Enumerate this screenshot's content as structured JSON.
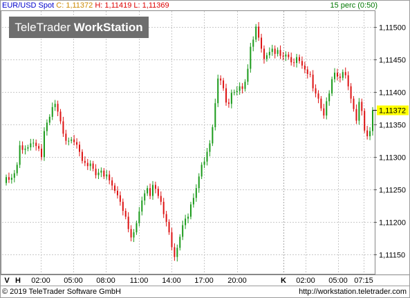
{
  "header": {
    "symbol": "EUR/USD Spot",
    "close_label": "C: 1,11372",
    "high_label": "H: 1,11419",
    "low_label": "L: 1,11369",
    "interval": "15 perc (0:50)"
  },
  "logo": {
    "word1": "TeleTrader",
    "word2": "WorkStation"
  },
  "footer": {
    "copyright": "© 2019 TeleTrader Software GmbH",
    "url": "http://workstation.teletrader.com"
  },
  "colors": {
    "up": "#1a9a1a",
    "down": "#dd1111",
    "grid": "#c8c8c8",
    "last_price_bg": "#ffff00",
    "close_label": "#cc8800",
    "high_label": "#dd0000",
    "low_label": "#dd0000",
    "interval_label": "#007700"
  },
  "chart_data": {
    "type": "candlestick",
    "title": "EUR/USD Spot",
    "interval": "15 perc",
    "y_ticks": [
      "1,11500",
      "1,11450",
      "1,11400",
      "1,11350",
      "1,11300",
      "1,11250",
      "1,11200",
      "1,11150"
    ],
    "ylim": [
      1.1112,
      1.11525
    ],
    "last_price": 1.11372,
    "last_price_label": "1,11372",
    "x_ticks": [
      {
        "label": "V",
        "bold": true
      },
      {
        "label": "H",
        "bold": true
      },
      {
        "label": "02:00"
      },
      {
        "label": "05:00"
      },
      {
        "label": "08:00"
      },
      {
        "label": "11:00"
      },
      {
        "label": "14:00"
      },
      {
        "label": "17:00"
      },
      {
        "label": "20:00"
      },
      {
        "label": "K",
        "bold": true
      },
      {
        "label": "02:00"
      },
      {
        "label": "05:00"
      },
      {
        "label": "07:15"
      }
    ],
    "close_series": [
      1.11269,
      1.11265,
      1.11268,
      1.11275,
      1.11288,
      1.11318,
      1.11311,
      1.11313,
      1.11315,
      1.11321,
      1.11322,
      1.11317,
      1.11313,
      1.113,
      1.1134,
      1.11353,
      1.11362,
      1.11377,
      1.11382,
      1.1137,
      1.11355,
      1.11336,
      1.11325,
      1.11325,
      1.11327,
      1.11323,
      1.11319,
      1.11308,
      1.11294,
      1.11291,
      1.11286,
      1.1129,
      1.11282,
      1.11272,
      1.11276,
      1.11279,
      1.1127,
      1.11273,
      1.11264,
      1.11256,
      1.11248,
      1.11241,
      1.11231,
      1.11217,
      1.11208,
      1.11189,
      1.11176,
      1.11184,
      1.11198,
      1.11216,
      1.11233,
      1.11244,
      1.11252,
      1.1124,
      1.11257,
      1.11251,
      1.1124,
      1.11231,
      1.11212,
      1.112,
      1.11184,
      1.11161,
      1.11146,
      1.1116,
      1.11177,
      1.11195,
      1.11205,
      1.11208,
      1.11227,
      1.11237,
      1.11252,
      1.1127,
      1.11288,
      1.11293,
      1.11308,
      1.11321,
      1.11346,
      1.11383,
      1.11421,
      1.11418,
      1.11406,
      1.11384,
      1.11382,
      1.11399,
      1.114,
      1.11402,
      1.11409,
      1.11405,
      1.11416,
      1.11436,
      1.1147,
      1.11481,
      1.11501,
      1.11484,
      1.11467,
      1.11451,
      1.11457,
      1.11462,
      1.11467,
      1.11459,
      1.11465,
      1.11456,
      1.11455,
      1.11458,
      1.11454,
      1.11446,
      1.11445,
      1.11454,
      1.11448,
      1.11441,
      1.11435,
      1.11428,
      1.11427,
      1.11406,
      1.11398,
      1.1139,
      1.11375,
      1.11364,
      1.11386,
      1.11398,
      1.1142,
      1.1143,
      1.11424,
      1.11422,
      1.11431,
      1.11426,
      1.11409,
      1.1139,
      1.11374,
      1.11356,
      1.11385,
      1.11371,
      1.11341,
      1.11332,
      1.1134,
      1.11372
    ],
    "xlabel": "",
    "ylabel": "",
    "grid": true
  }
}
